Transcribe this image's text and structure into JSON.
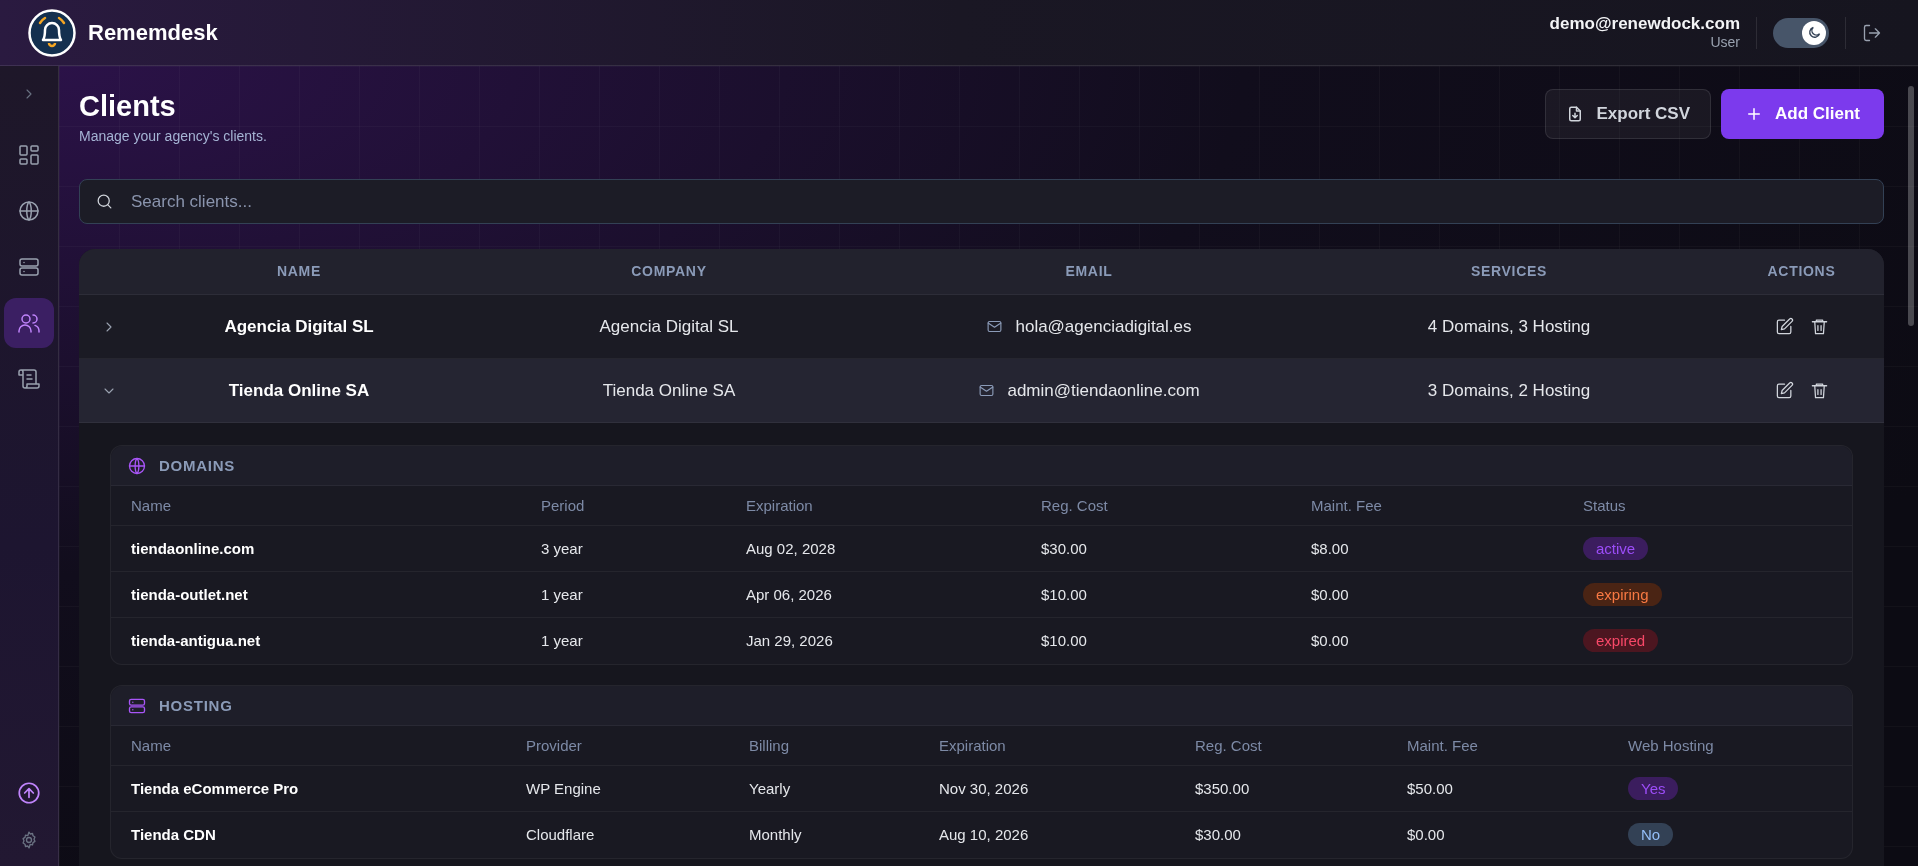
{
  "app": {
    "name": "Rememdesk"
  },
  "user": {
    "email": "demo@renewdock.com",
    "role": "User"
  },
  "theme_toggle": {
    "on": true
  },
  "sidebar": {
    "items": [
      {
        "kind": "dashboard",
        "selected": false
      },
      {
        "kind": "globe",
        "selected": false
      },
      {
        "kind": "server",
        "selected": false
      },
      {
        "kind": "users",
        "selected": true
      },
      {
        "kind": "scroll",
        "selected": false
      }
    ],
    "bottom": [
      {
        "kind": "upgrade"
      },
      {
        "kind": "settings"
      }
    ]
  },
  "page": {
    "title": "Clients",
    "subtitle": "Manage your agency's clients."
  },
  "buttons": [
    {
      "kind": "export",
      "label": "Export CSV"
    },
    {
      "kind": "add",
      "label": "Add Client"
    }
  ],
  "search": {
    "placeholder": "Search clients..."
  },
  "table": {
    "columns": [
      "NAME",
      "COMPANY",
      "EMAIL",
      "SERVICES",
      "ACTIONS"
    ],
    "rows": [
      {
        "name": "Agencia Digital SL",
        "company": "Agencia Digital SL",
        "email": "hola@agenciadigital.es",
        "services": "4 Domains, 3 Hosting",
        "expanded": false
      },
      {
        "name": "Tienda Online SA",
        "company": "Tienda Online SA",
        "email": "admin@tiendaonline.com",
        "services": "3 Domains, 2 Hosting",
        "expanded": true
      }
    ]
  },
  "domains": {
    "title": "DOMAINS",
    "columns": [
      "Name",
      "Period",
      "Expiration",
      "Reg. Cost",
      "Maint. Fee",
      "Status"
    ],
    "rows": [
      {
        "cells": [
          "tiendaonline.com",
          "3 year",
          "Aug 02, 2028",
          "$30.00",
          "$8.00"
        ],
        "status": "active",
        "color": "#3b1d5e"
      },
      {
        "cells": [
          "tienda-outlet.net",
          "1 year",
          "Apr 06, 2026",
          "$10.00",
          "$0.00"
        ],
        "status": "expiring",
        "color": "#4a2414"
      },
      {
        "cells": [
          "tienda-antigua.net",
          "1 year",
          "Jan 29, 2026",
          "$10.00",
          "$0.00"
        ],
        "status": "expired",
        "color": "#4c1620"
      }
    ]
  },
  "hosting": {
    "title": "HOSTING",
    "columns": [
      "Name",
      "Provider",
      "Billing",
      "Expiration",
      "Reg. Cost",
      "Maint. Fee",
      "Web Hosting"
    ],
    "rows": [
      {
        "cells": [
          "Tienda eCommerce Pro",
          "WP Engine",
          "Yearly",
          "Nov 30, 2026",
          "$350.00",
          "$50.00"
        ],
        "web_hosting": "Yes",
        "color": "#3b1d5e"
      },
      {
        "cells": [
          "Tienda CDN",
          "Cloudflare",
          "Monthly",
          "Aug 10, 2026",
          "$30.00",
          "$0.00"
        ],
        "web_hosting": "No",
        "color": "#334155"
      }
    ]
  }
}
